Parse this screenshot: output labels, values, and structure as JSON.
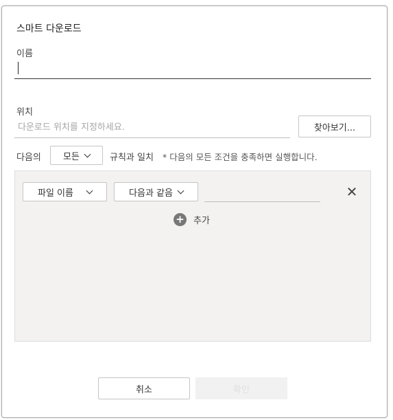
{
  "dialog": {
    "title": "스마트 다운로드"
  },
  "name": {
    "label": "이름",
    "value": ""
  },
  "location": {
    "label": "위치",
    "placeholder": "다운로드 위치를 지정하세요.",
    "browse_label": "찾아보기..."
  },
  "match": {
    "prefix": "다음의",
    "selected": "모든",
    "suffix": "규칙과 일치",
    "note": "* 다음의 모든 조건을 충족하면 실행합니다."
  },
  "rule": {
    "field": "파일 이름",
    "operator": "다음과 같음",
    "value": "",
    "add_label": "추가"
  },
  "buttons": {
    "cancel": "취소",
    "ok": "확인"
  },
  "icons": {
    "dropdown": "chevron-down-icon",
    "close": "close-icon",
    "add": "plus-circle-icon"
  },
  "colors": {
    "panel_bg": "#f3f2f0",
    "add_icon": "#777777",
    "disabled_button": "#f1f1f1"
  }
}
